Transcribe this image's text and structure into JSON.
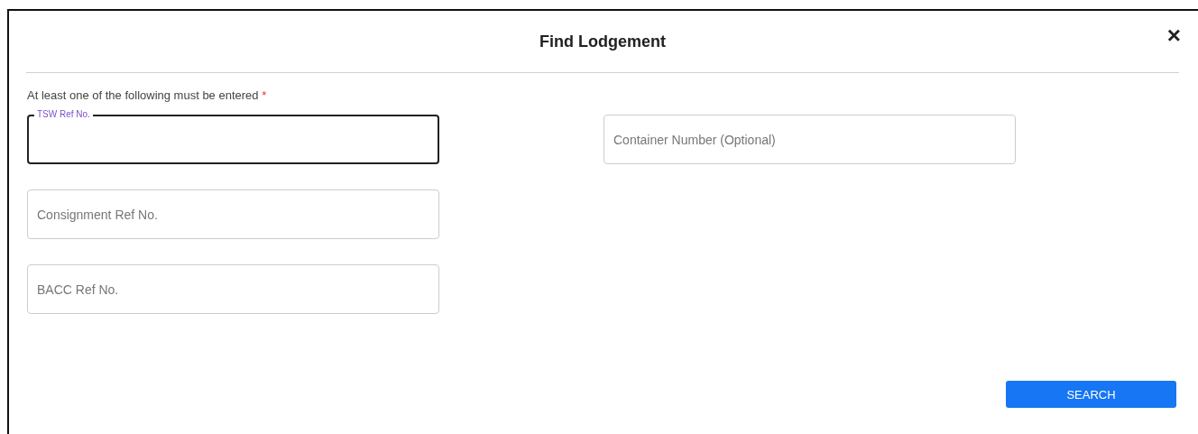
{
  "dialog": {
    "title": "Find Lodgement",
    "close": "×"
  },
  "note": {
    "text": "At least one of the following must be entered",
    "required_mark": "*"
  },
  "columns": [
    {
      "fields": [
        {
          "placeholder": "TSW Ref No.",
          "focused": true
        },
        {
          "placeholder": "Consignment Ref No.",
          "focused": false
        },
        {
          "placeholder": "BACC Ref No.",
          "focused": false
        }
      ]
    },
    {
      "fields": [
        {
          "placeholder": "Container Number (Optional)",
          "focused": false
        }
      ]
    }
  ],
  "search_button": "SEARCH"
}
